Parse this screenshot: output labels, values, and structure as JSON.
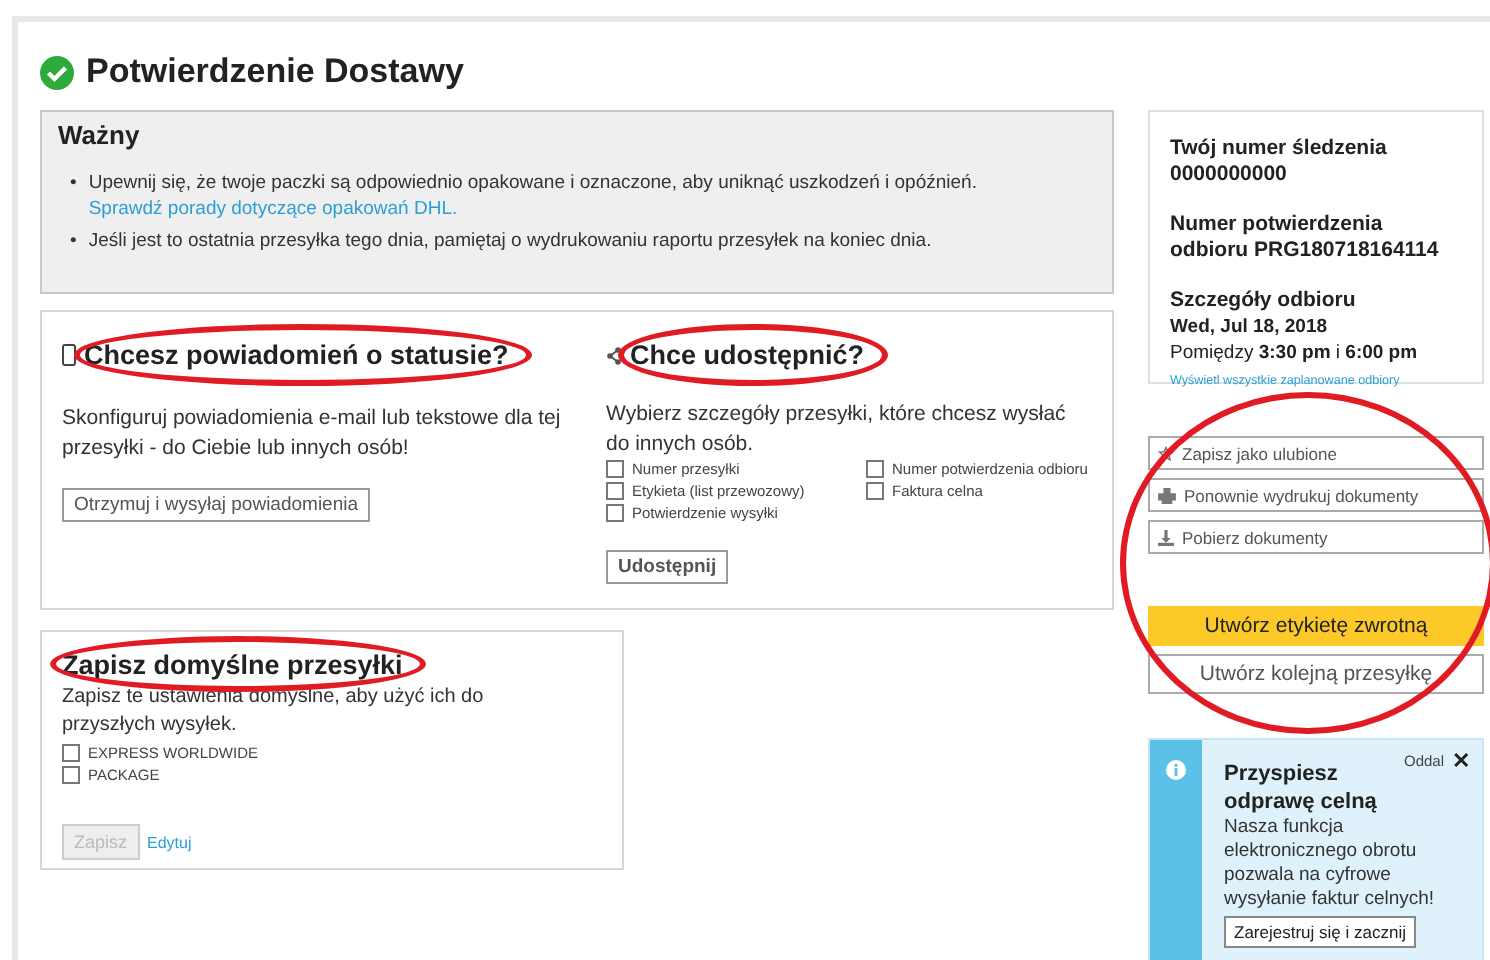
{
  "header": {
    "title": "Potwierdzenie Dostawy"
  },
  "notice": {
    "title": "Ważny",
    "items": [
      {
        "bullet": "•",
        "text": "Upewnij się, że twoje paczki są odpowiednio opakowane i oznaczone, aby uniknąć uszkodzeń i opóźnień.",
        "link": "Sprawdź porady dotyczące opakowań DHL."
      },
      {
        "bullet": "•",
        "text": "Jeśli jest to ostatnia przesyłka tego dnia, pamiętaj o wydrukowaniu raportu przesyłek na koniec dnia."
      }
    ]
  },
  "notifications": {
    "title": "Chcesz powiadomień o statusie?",
    "circled": true,
    "description": "Skonfiguruj powiadomienia e-mail lub tekstowe dla tej przesyłki - do Ciebie lub innych osób!",
    "button": "Otrzymuj i wysyłaj powiadomienia"
  },
  "share": {
    "title": "Chce udostępnić?",
    "circled": true,
    "description": "Wybierz szczegóły przesyłki, które chcesz wysłać do innych osób.",
    "options": [
      {
        "label": "Numer przesyłki",
        "checked": false
      },
      {
        "label": "Numer potwierdzenia odbioru",
        "checked": false
      },
      {
        "label": "Etykieta (list przewozowy)",
        "checked": false
      },
      {
        "label": "Faktura celna",
        "checked": false
      },
      {
        "label": "Potwierdzenie wysyłki",
        "checked": false
      }
    ],
    "button": "Udostępnij"
  },
  "defaults": {
    "title": "Zapisz domyślne przesyłki",
    "circled": true,
    "description": "Zapisz te ustawienia domyślne, aby użyć ich do przyszłych wysyłek.",
    "options": [
      {
        "label": "EXPRESS WORLDWIDE",
        "checked": false
      },
      {
        "label": "PACKAGE",
        "checked": false
      }
    ],
    "save_button": {
      "label": "Zapisz",
      "disabled": true
    },
    "edit_link": "Edytuj"
  },
  "tracking": {
    "tracking_label": "Twój numer śledzenia",
    "tracking_number": "0000000000",
    "confirmation_label": "Numer potwierdzenia odbioru PRG180718164114",
    "pickup_title": "Szczegóły odbioru",
    "pickup_date": "Wed, Jul 18, 2018",
    "pickup_window": "Pomiędzy **3:30 pm** i **6:00 pm**",
    "pickup_link": "Wyświetl wszystkie zaplanowane odbiory"
  },
  "actions": {
    "circled": true,
    "items": [
      {
        "kind": "favorite",
        "label": "Zapisz jako ulubione"
      },
      {
        "kind": "print",
        "label": "Ponownie wydrukuj dokumenty"
      },
      {
        "kind": "download",
        "label": "Pobierz dokumenty"
      }
    ],
    "primary": "Utwórz etykietę zwrotną",
    "secondary": "Utwórz kolejną przesyłkę"
  },
  "promo": {
    "dismiss": "Oddal",
    "close": "✕",
    "title": "Przyspiesz odprawę celną",
    "text": "Nasza funkcja elektronicznego obrotu pozwala na cyfrowe wysyłanie faktur celnych!",
    "button": "Zarejestruj się i zacznij"
  }
}
